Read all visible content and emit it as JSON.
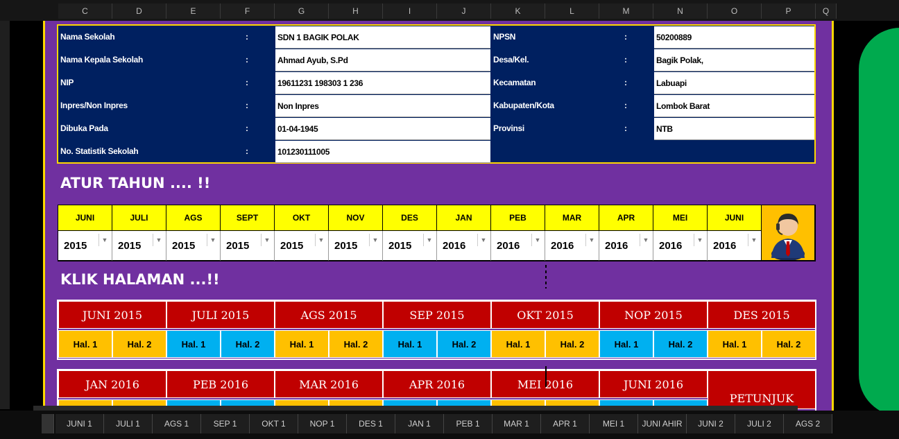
{
  "columns": [
    "C",
    "D",
    "E",
    "F",
    "G",
    "H",
    "I",
    "J",
    "K",
    "L",
    "M",
    "N",
    "O",
    "P",
    "Q"
  ],
  "school_left": [
    {
      "label": "Nama Sekolah",
      "colon": ":",
      "value": "SDN 1 BAGIK POLAK"
    },
    {
      "label": "Nama Kepala Sekolah",
      "colon": ":",
      "value": "Ahmad Ayub, S.Pd"
    },
    {
      "label": "NIP",
      "colon": ":",
      "value": "19611231 198303 1 236"
    },
    {
      "label": "Inpres/Non Inpres",
      "colon": ":",
      "value": "Non Inpres"
    },
    {
      "label": "Dibuka Pada",
      "colon": ":",
      "value": "01-04-1945"
    },
    {
      "label": "No. Statistik Sekolah",
      "colon": ":",
      "value": "101230111005"
    }
  ],
  "school_right": [
    {
      "label": "NPSN",
      "colon": ":",
      "value": "50200889"
    },
    {
      "label": "Desa/Kel.",
      "colon": ":",
      "value": "Bagik Polak,"
    },
    {
      "label": "Kecamatan",
      "colon": ":",
      "value": "Labuapi"
    },
    {
      "label": "Kabupaten/Kota",
      "colon": ":",
      "value": "Lombok Barat"
    },
    {
      "label": "Provinsi",
      "colon": ":",
      "value": "NTB"
    }
  ],
  "titles": {
    "atur": "ATUR TAHUN .... !!",
    "klik": "KLIK HALAMAN ...!!"
  },
  "months": [
    "JUNI",
    "JULI",
    "AGS",
    "SEPT",
    "OKT",
    "NOV",
    "DES",
    "JAN",
    "PEB",
    "MAR",
    "APR",
    "MEI",
    "JUNI"
  ],
  "years": [
    "2015",
    "2015",
    "2015",
    "2015",
    "2015",
    "2015",
    "2015",
    "2016",
    "2016",
    "2016",
    "2016",
    "2016",
    "2016"
  ],
  "pages_row1": [
    "JUNI 2015",
    "JULI 2015",
    "AGS 2015",
    "SEP 2015",
    "OKT 2015",
    "NOP 2015",
    "DES 2015"
  ],
  "pages_row2": [
    "JAN 2016",
    "PEB 2016",
    "MAR 2016",
    "APR 2016",
    "MEI 2016",
    "JUNI 2016"
  ],
  "hal": {
    "h1": "Hal. 1",
    "h2": "Hal. 2"
  },
  "petunjuk": "PETUNJUK",
  "tabs": [
    "JUNI 1",
    "JULI 1",
    "AGS 1",
    "SEP 1",
    "OKT 1",
    "NOP 1",
    "DES 1",
    "JAN 1",
    "PEB 1",
    "MAR 1",
    "APR 1",
    "MEI 1",
    "JUNI AHIR",
    "JUNI 2",
    "JULI 2",
    "AGS 2"
  ],
  "colors": {
    "purple": "#7030a0",
    "navy": "#002060",
    "yellow": "#ffff00",
    "red": "#c00000",
    "orange": "#ffc000",
    "blue": "#00b0f0",
    "green": "#00aa4e"
  }
}
